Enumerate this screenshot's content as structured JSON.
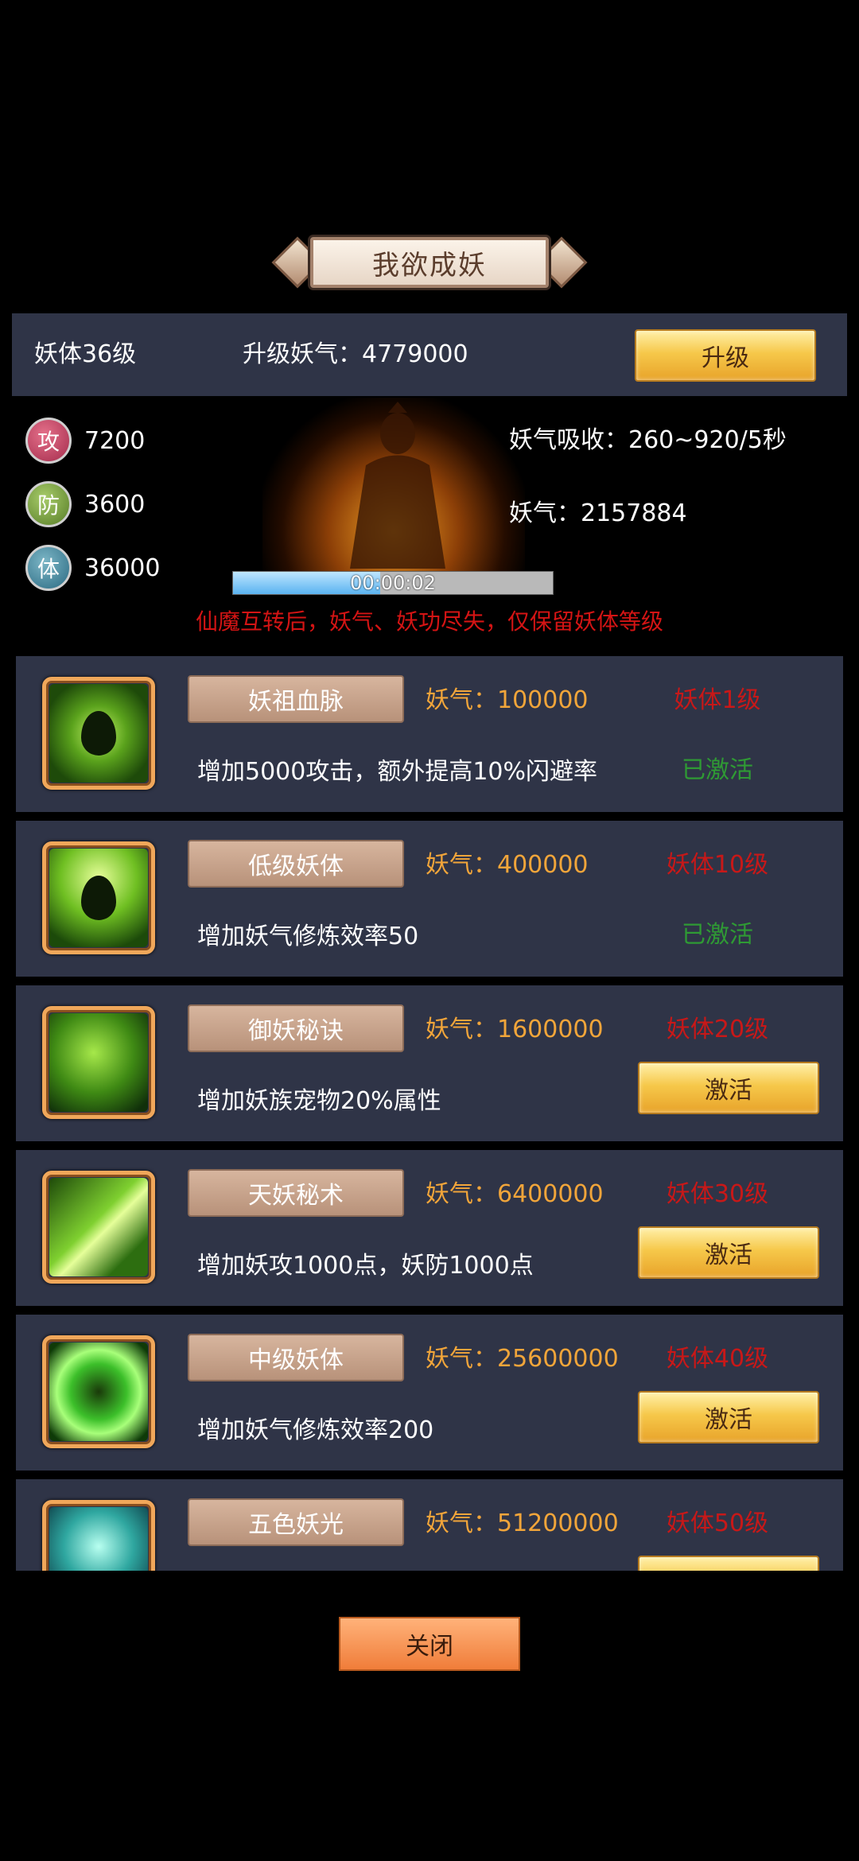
{
  "title": "我欲成妖",
  "header": {
    "level": "妖体36级",
    "upgrade_cost": "升级妖气：4779000",
    "upgrade_button": "升级"
  },
  "stats": [
    {
      "badge": "攻",
      "value": "7200"
    },
    {
      "badge": "防",
      "value": "3600"
    },
    {
      "badge": "体",
      "value": "36000"
    }
  ],
  "absorb": "妖气吸收：260~920/5秒",
  "qi": "妖气：2157884",
  "timer": {
    "text": "00:00:02",
    "progress": 0.46
  },
  "warning": "仙魔互转后，妖气、妖功尽失，仅保留妖体等级",
  "skills": [
    {
      "name": "妖祖血脉",
      "cost": "妖气：100000",
      "req": "妖体1级",
      "desc": "增加5000攻击，额外提高10%闪避率",
      "status": "已激活"
    },
    {
      "name": "低级妖体",
      "cost": "妖气：400000",
      "req": "妖体10级",
      "desc": "增加妖气修炼效率50",
      "status": "已激活"
    },
    {
      "name": "御妖秘诀",
      "cost": "妖气：1600000",
      "req": "妖体20级",
      "desc": "增加妖族宠物20%属性",
      "button": "激活"
    },
    {
      "name": "天妖秘术",
      "cost": "妖气：6400000",
      "req": "妖体30级",
      "desc": "增加妖攻1000点，妖防1000点",
      "button": "激活"
    },
    {
      "name": "中级妖体",
      "cost": "妖气：25600000",
      "req": "妖体40级",
      "desc": "增加妖气修炼效率200",
      "button": "激活"
    },
    {
      "name": "五色妖光",
      "cost": "妖气：51200000",
      "req": "妖体50级",
      "desc": "",
      "button": ""
    }
  ],
  "close_button": "关闭",
  "colors": {
    "panel": "#2f3447",
    "cost": "#f1a53a",
    "req": "#c81818",
    "activated": "#2f9a34"
  }
}
